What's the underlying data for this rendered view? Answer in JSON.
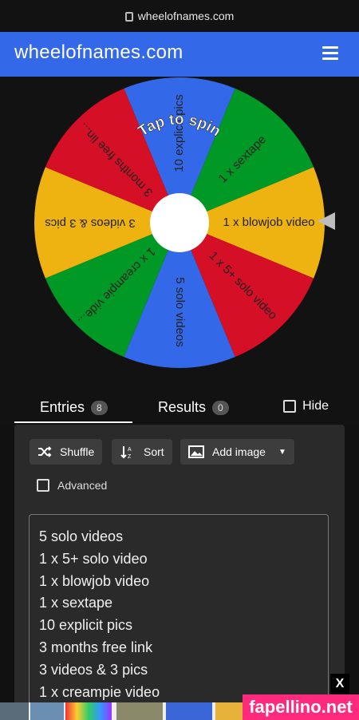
{
  "browser": {
    "url": "wheelofnames.com"
  },
  "header": {
    "title": "wheelofnames.com"
  },
  "wheel": {
    "center_label": "Tap to spin",
    "segments": [
      {
        "label": "10 explicit pics",
        "color": "#3369e8"
      },
      {
        "label": "1 x sextape",
        "color": "#009925"
      },
      {
        "label": "1 x blowjob video",
        "color": "#eeb211"
      },
      {
        "label": "1 x 5+ solo video",
        "color": "#d50f25"
      },
      {
        "label": "5 solo videos",
        "color": "#3369e8"
      },
      {
        "label": "1 x creampie vide...",
        "color": "#009925"
      },
      {
        "label": "3 videos & 3 pics",
        "color": "#eeb211"
      },
      {
        "label": "3 months free lin...",
        "color": "#d50f25"
      }
    ]
  },
  "tabs": {
    "entries_label": "Entries",
    "entries_count": "8",
    "results_label": "Results",
    "results_count": "0",
    "hide_label": "Hide"
  },
  "toolbar": {
    "shuffle": "Shuffle",
    "sort": "Sort",
    "add_image": "Add image",
    "advanced": "Advanced"
  },
  "entries": [
    "5 solo videos",
    "1 x 5+ solo video",
    "1 x blowjob video",
    "1 x sextape",
    "10 explicit pics",
    "3 months free link",
    "3 videos & 3 pics",
    "1 x creampie video"
  ],
  "ad": {
    "close": "X",
    "brand": "fapellino.net"
  }
}
